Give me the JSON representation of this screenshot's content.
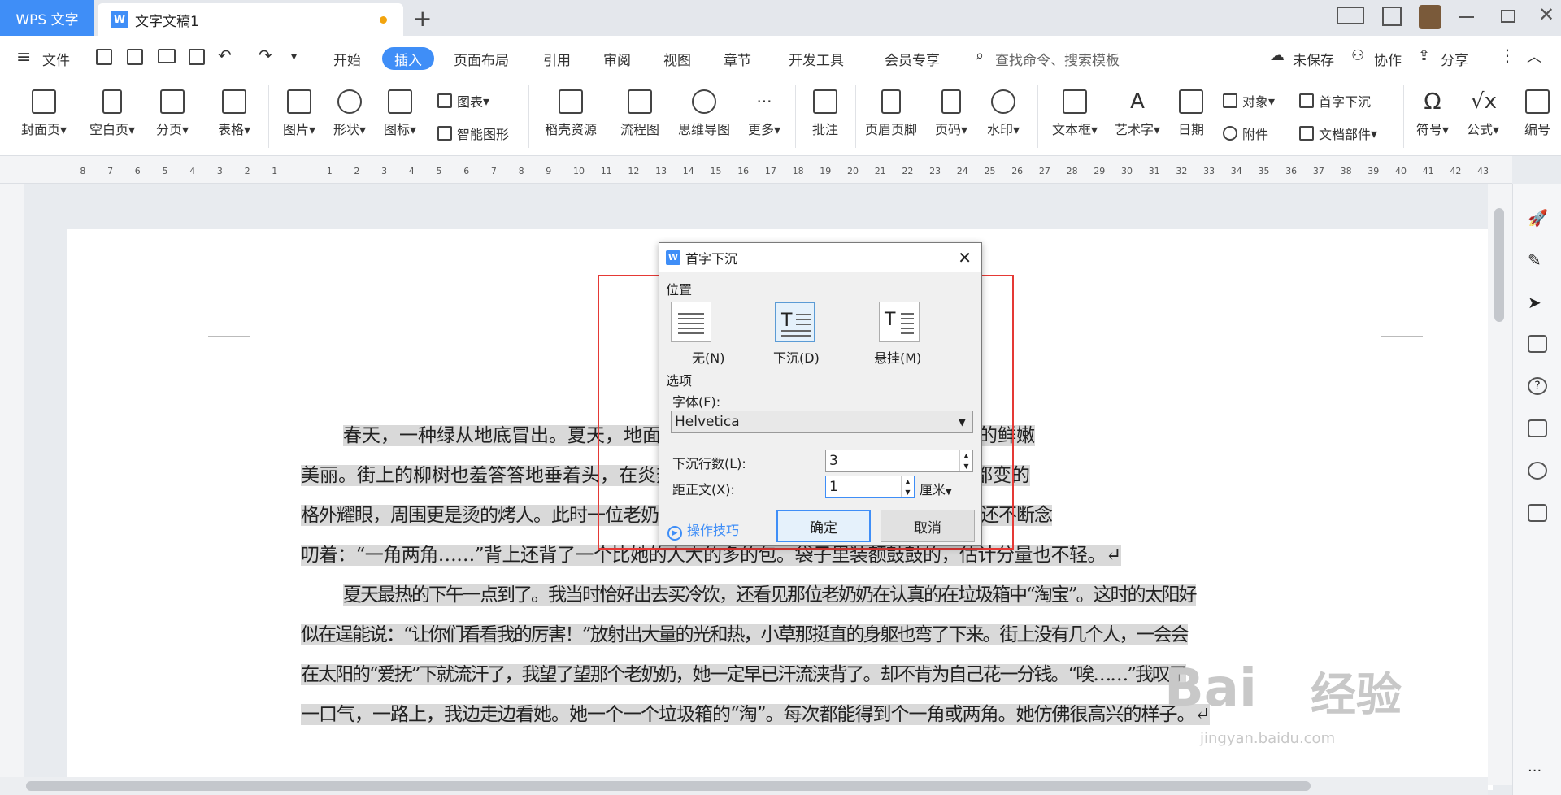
{
  "titlebar": {
    "app": "WPS 文字",
    "doc_title": "文字文稿1",
    "new_tab": "+"
  },
  "menubar": {
    "file": "文件",
    "tabs": [
      "开始",
      "插入",
      "页面布局",
      "引用",
      "审阅",
      "视图",
      "章节",
      "开发工具",
      "会员专享"
    ],
    "active_tab": "插入",
    "search_placeholder": "查找命令、搜索模板",
    "unsaved": "未保存",
    "collab": "协作",
    "share": "分享"
  },
  "ribbon": {
    "cover": "封面页",
    "blank": "空白页",
    "pagebreak": "分页",
    "table": "表格",
    "picture": "图片",
    "shape": "形状",
    "icon": "图标",
    "chart": "图表",
    "smart": "智能图形",
    "docer": "稻壳资源",
    "flow": "流程图",
    "mind": "思维导图",
    "more": "更多",
    "comment": "批注",
    "headerfooter": "页眉页脚",
    "pagenum": "页码",
    "watermark": "水印",
    "textbox": "文本框",
    "wordart": "艺术字",
    "date": "日期",
    "object": "对象",
    "attach": "附件",
    "dropcap": "首字下沉",
    "docpart": "文档部件",
    "symbol": "符号",
    "formula": "公式",
    "edit": "编号"
  },
  "ruler": {
    "left_numbers": [
      "8",
      "7",
      "6",
      "5",
      "4",
      "3",
      "2",
      "1"
    ],
    "right_numbers": [
      "1",
      "2",
      "3",
      "4",
      "5",
      "6",
      "7",
      "8",
      "9",
      "10",
      "11",
      "12",
      "13",
      "14",
      "15",
      "16",
      "17",
      "18",
      "19",
      "20",
      "21",
      "22",
      "23",
      "24",
      "25",
      "26",
      "27",
      "28",
      "29",
      "30",
      "31",
      "32",
      "33",
      "34",
      "35",
      "36",
      "37",
      "38",
      "39",
      "40",
      "41",
      "42",
      "43"
    ]
  },
  "document": {
    "lines": [
      {
        "text": "春天，一种绿从地底冒出。夏天，地面上的小草身上，像涂了明油一般。那样的鲜嫩",
        "hl": true
      },
      {
        "text": "美丽。街上的柳树也羞答答地垂着头，在炎热的中午，格外的炎热，墙壁上、地上都变的",
        "hl": true
      },
      {
        "text": "格外耀眼，周围更是烫的烤人。此时一位老奶奶在工作——一丝不苟的捡垃圾，边捡，还不断念",
        "hl": true
      },
      {
        "text": "叨着：“一角两角……”背上还背了一个比她的人大的多的包。袋子里装额鼓鼓的，估计分量也不轻。↵",
        "hl": true
      },
      {
        "text": "夏天最热的下午一点到了。我当时恰好出去买冷饮，还看见那位老奶奶在认真的在垃圾箱中“淘宝”。这时的太阳好",
        "hl": true
      },
      {
        "text": "似在逞能说：“让你们看看我的厉害！”放射出大量的光和热，小草那挺直的身躯也弯了下来。街上没有几个人，一会会",
        "hl": true
      },
      {
        "text": "在太阳的“爱抚”下就流汗了，我望了望那个老奶奶，她一定早已汗流浃背了。却不肯为自己花一分钱。“唉……”我叹了",
        "hl": true
      },
      {
        "text": "一口气，一路上，我边走边看她。她一个一个垃圾箱的“淘”。每次都能得到个一角或两角。她仿佛很高兴的样子。↵",
        "hl": true
      }
    ]
  },
  "dialog": {
    "title": "首字下沉",
    "position_label": "位置",
    "opt_none": "无(N)",
    "opt_drop": "下沉(D)",
    "opt_hang": "悬挂(M)",
    "options_label": "选项",
    "font_label": "字体(F):",
    "font_value": "Helvetica",
    "lines_label": "下沉行数(L):",
    "lines_value": "3",
    "distance_label": "距正文(X):",
    "distance_value": "1",
    "unit": "厘米",
    "tips": "操作技巧",
    "ok": "确定",
    "cancel": "取消"
  },
  "watermark": {
    "brand": "Bai",
    "brand2": "经验",
    "url": "jingyan.baidu.com"
  },
  "colors": {
    "accent": "#3f8ef7",
    "highlight_box": "#e53935",
    "selection": "#d9d9d9"
  }
}
